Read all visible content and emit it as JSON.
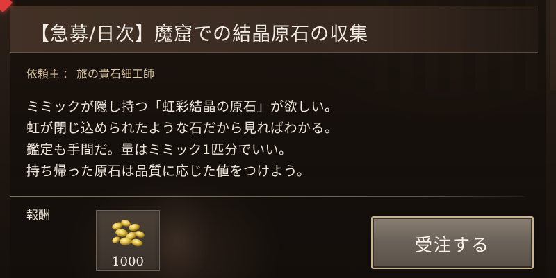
{
  "quest": {
    "title": "【急募/日次】魔窟での結晶原石の収集",
    "client_label": "依頼主",
    "client_sep": "：",
    "client_name": "旅の貴石細工師",
    "description_lines": [
      "ミミックが隠し持つ「虹彩結晶の原石」が欲しい。",
      "虹が閉じ込められたような石だから見ればわかる。",
      "鑑定も手間だ。量はミミック1匹分でいい。",
      "持ち帰った原石は品質に応じた値をつけよう。"
    ]
  },
  "reward": {
    "label": "報酬",
    "item_icon": "gold-coins-icon",
    "count": "1000"
  },
  "actions": {
    "accept_label": "受注する"
  },
  "colors": {
    "title_text": "#f2ece4",
    "client_text": "#d8c6a4",
    "button_border": "#c8b58e",
    "corner_gem": "#e03a3a"
  }
}
